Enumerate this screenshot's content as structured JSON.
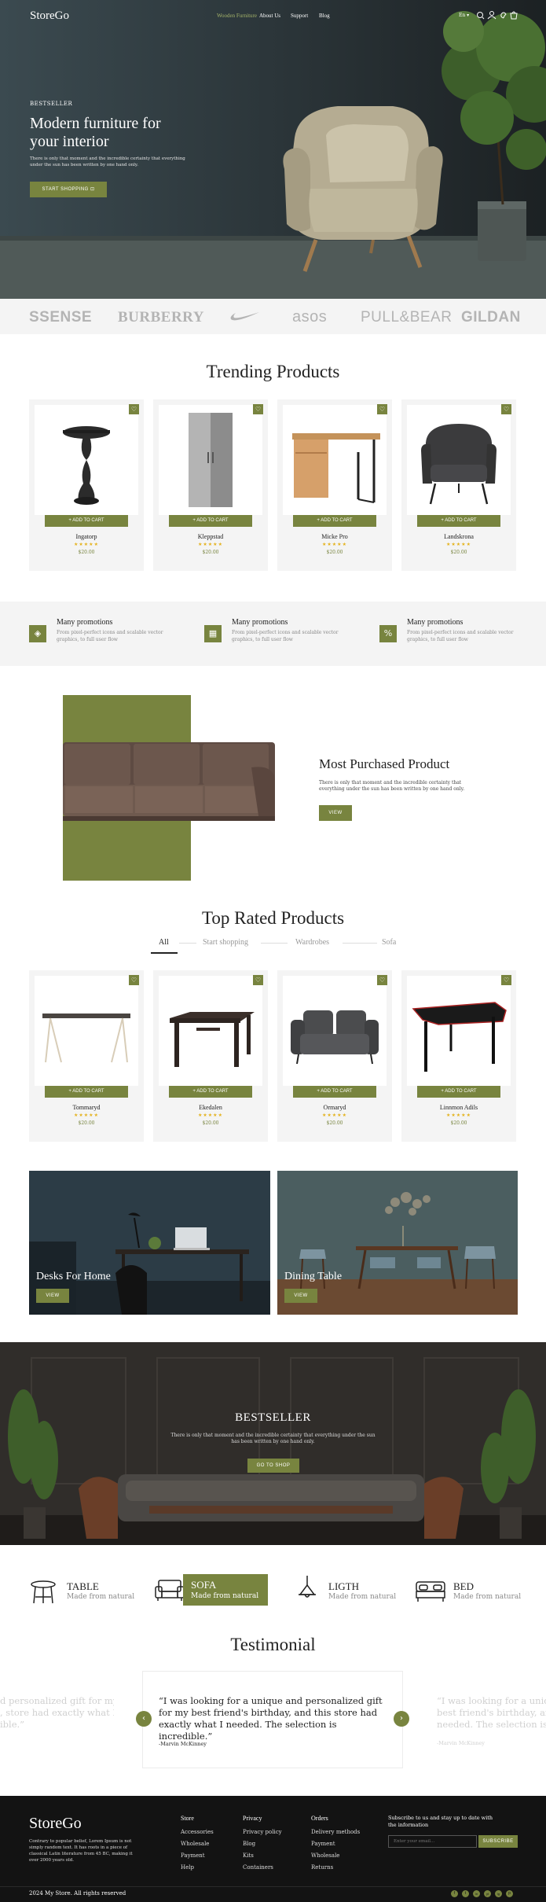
{
  "header": {
    "logo": "StoreGo",
    "nav": [
      "Wooden Furniture",
      "About Us",
      "Support",
      "Blog"
    ],
    "lang": "En"
  },
  "hero": {
    "eyebrow": "BESTSELLER",
    "title": "Modern furniture for your interior",
    "text": "There is only that moment and the incredible certainty that everything under the sun has been written by one hand only.",
    "button": "START SHOPPING"
  },
  "brands": [
    "SSENSE",
    "BURBERRY",
    "nike-logo",
    "asos",
    "PULL&BEAR",
    "GILDAN"
  ],
  "trending": {
    "title": "Trending Products",
    "add_label": "ADD TO CART",
    "products": [
      {
        "name": "Ingatorp",
        "price": "$20.00",
        "rating": 5,
        "icon": "round-side-table"
      },
      {
        "name": "Kleppstad",
        "price": "$20.00",
        "rating": 5,
        "icon": "wardrobe"
      },
      {
        "name": "Micke Pro",
        "price": "$20.00",
        "rating": 5,
        "icon": "desk"
      },
      {
        "name": "Landskrona",
        "price": "$20.00",
        "rating": 5,
        "icon": "armchair"
      }
    ]
  },
  "features": [
    {
      "title": "Many promotions",
      "text": "From pixel-perfect icons and scalable vector graphics, to full user flow",
      "icon": "tag-icon"
    },
    {
      "title": "Many promotions",
      "text": "From pixel-perfect icons and scalable vector graphics, to full user flow",
      "icon": "store-icon"
    },
    {
      "title": "Many promotions",
      "text": "From pixel-perfect icons and scalable vector graphics, to full user flow",
      "icon": "percent-icon"
    }
  ],
  "most": {
    "title": "Most Purchased Product",
    "text": "There is only that moment and the incredible certainty that everything under the sun has been written by one hand only.",
    "button": "VIEW"
  },
  "top": {
    "title": "Top Rated Products",
    "tabs": [
      "All",
      "Start shopping",
      "Wardrobes",
      "Sofa"
    ],
    "add_label": "ADD TO CART",
    "products": [
      {
        "name": "Tommaryd",
        "price": "$20.00",
        "rating": 5,
        "icon": "trestle-table"
      },
      {
        "name": "Ekedalen",
        "price": "$20.00",
        "rating": 5,
        "icon": "dining-table"
      },
      {
        "name": "Ormaryd",
        "price": "$20.00",
        "rating": 5,
        "icon": "sofa"
      },
      {
        "name": "Linnmon Adils",
        "price": "$20.00",
        "rating": 5,
        "icon": "gaming-desk"
      }
    ]
  },
  "banners": [
    {
      "label": "Desks For Home",
      "button": "VIEW"
    },
    {
      "label": "Dining Table",
      "button": "VIEW"
    }
  ],
  "bestseller": {
    "title": "BESTSELLER",
    "text": "There is only that moment and the incredible certainty that everything under the sun has been written by one hand only.",
    "button": "GO TO SHOP"
  },
  "categories": [
    {
      "title": "TABLE",
      "sub": "Made from natural",
      "icon": "stool-icon",
      "active": false
    },
    {
      "title": "SOFA",
      "sub": "Made from natural",
      "icon": "sofa-icon",
      "active": true
    },
    {
      "title": "LIGTH",
      "sub": "Made from natural",
      "icon": "lamp-icon",
      "active": false
    },
    {
      "title": "BED",
      "sub": "Made from natural",
      "icon": "bed-icon",
      "active": false
    }
  ],
  "testimonial": {
    "title": "Testimonial",
    "quote": "“I was looking for a unique and personalized gift for my best friend's birthday, and this store had exactly what I needed. The selection is incredible.”",
    "author": "-Marvin McKinney",
    "left_quote": "d personalized gift for my\n, store had exactly what I\nible.”",
    "right_quote": "“I was looking for a unique a\nbest friend's birthday, and th\nneeded. The selection is incr",
    "right_author": "-Marvin McKinney"
  },
  "footer": {
    "logo": "StoreGo",
    "about": "Contrary to popular belief, Lorem Ipsum is not simply random text. It has roots in a piece of classical Latin literature from 45 BC, making it over 2000 years old.",
    "cols": [
      {
        "title": "Store",
        "items": [
          "Accessories",
          "Wholesale",
          "Payment",
          "Help"
        ]
      },
      {
        "title": "Privacy",
        "items": [
          "Privacy policy",
          "Blog",
          "Kits",
          "Containers"
        ]
      },
      {
        "title": "Orders",
        "items": [
          "Delivery methods",
          "Payment",
          "Wholesale",
          "Returns"
        ]
      }
    ],
    "subscribe_text": "Subscribe to us and stay up to date with the information",
    "email_placeholder": "Enter your email...",
    "subscribe_button": "SUBSCRIBE",
    "copyright": "2024 My Store. All rights reserved",
    "socials": [
      "f",
      "t",
      "in",
      "yt",
      "ig",
      "p"
    ]
  },
  "colors": {
    "accent": "#78843f",
    "dark": "#131313",
    "light": "#f4f4f4",
    "star": "#e4b21c"
  }
}
